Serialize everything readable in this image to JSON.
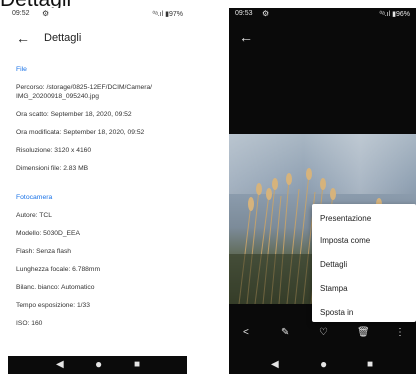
{
  "top_title": "Dettagli",
  "left_status": {
    "time": "09:52",
    "gear": "⚙",
    "right": "⁰ᵃ.ıl ▮97%"
  },
  "details": {
    "title": "Dettagli",
    "back": "←",
    "section_file": "File",
    "percorso": "Percorso: /storage/0825-12EF/DCIM/Camera/ IMG_20200918_095240.jpg",
    "ora_scatto": "Ora scatto: September 18, 2020, 09:52",
    "ora_modificata": "Ora modificata: September 18, 2020, 09:52",
    "risoluzione": "Risoluzione: 3120 x 4160",
    "dimensioni": "Dimensioni file: 2.83 MB",
    "section_camera": "Fotocamera",
    "autore": "Autore: TCL",
    "modello": "Modello: 5030D_EEA",
    "flash": "Flash: Senza flash",
    "lunghezza": "Lunghezza focale: 6.788mm",
    "bilanc": "Bilanc. bianco: Automatico",
    "tempo": "Tempo esposizione: 1/33",
    "iso": "ISO: 160"
  },
  "right_status": {
    "time": "09:53",
    "gear": "⚙",
    "right": "⁰ᵃ.ıl ▮96%"
  },
  "viewer": {
    "back": "←"
  },
  "menu": {
    "presentazione": "Presentazione",
    "imposta_come": "Imposta come",
    "dettagli": "Dettagli",
    "stampa": "Stampa",
    "sposta_in": "Sposta in"
  },
  "toolbar": {
    "share_icon": "<",
    "edit_icon": "✎",
    "fav_icon": "♡",
    "delete_icon": "🗑",
    "more_icon": "⋮"
  },
  "nav": {
    "back": "◀",
    "home": "●",
    "recents": "■"
  }
}
